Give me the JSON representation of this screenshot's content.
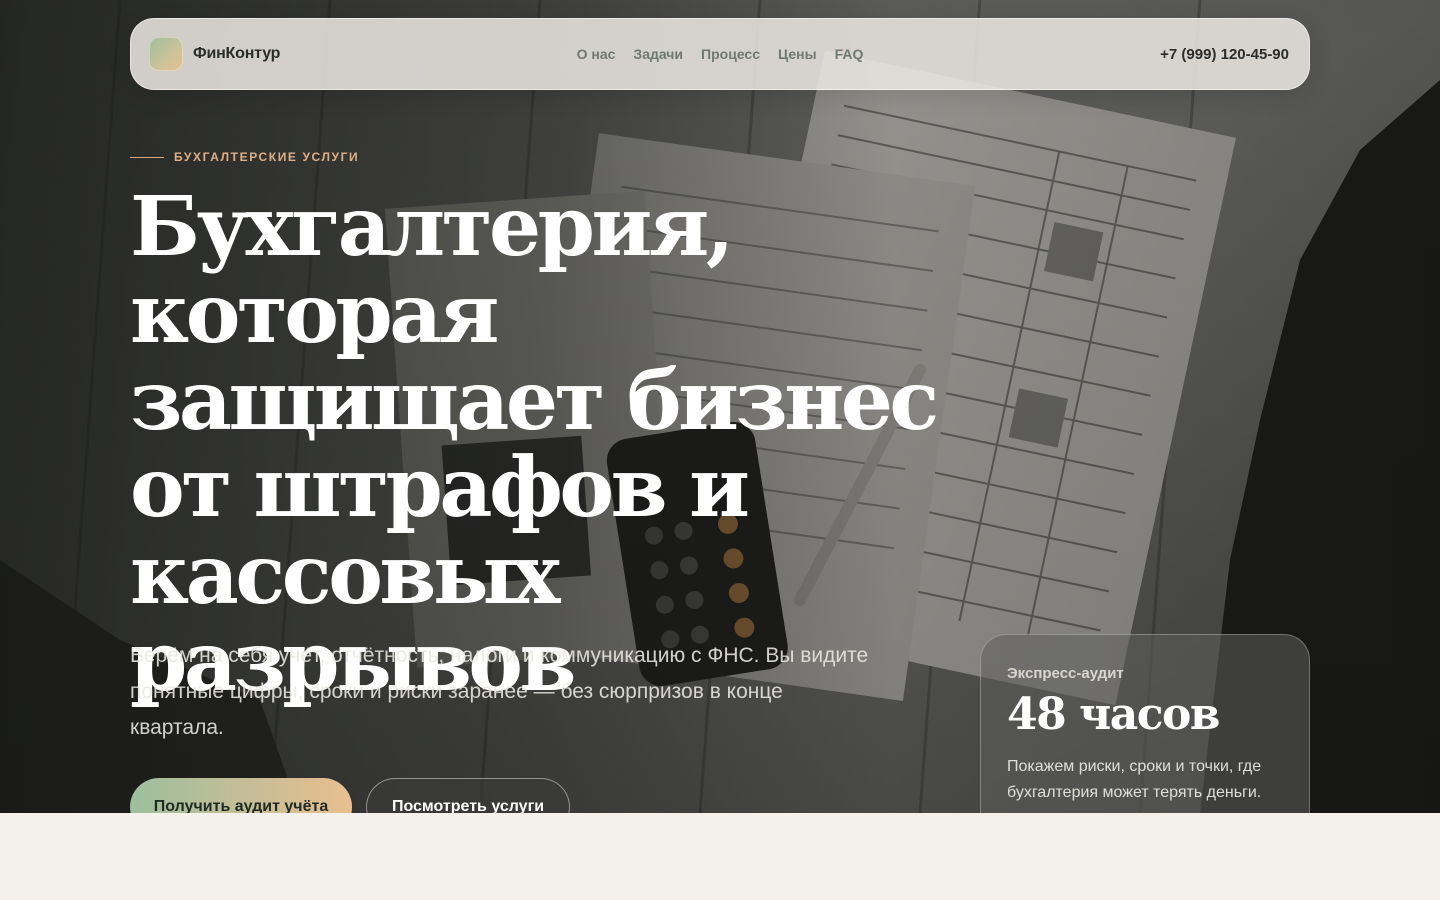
{
  "nav": {
    "brand": "ФинКонтур",
    "links": [
      "О нас",
      "Задачи",
      "Процесс",
      "Цены",
      "FAQ"
    ],
    "phone": "+7 (999) 120-45-90"
  },
  "hero": {
    "eyebrow": "БУХГАЛТЕРСКИЕ УСЛУГИ",
    "headline": "Бухгалтерия, которая защищает бизнес от штрафов и кассовых разрывов",
    "subtext": "Берём на себя учёт, отчётность, налоги и коммуникацию с ФНС. Вы видите понятные цифры, сроки и риски заранее — без сюрпризов в конце квартала.",
    "primary_cta": "Получить аудит учёта",
    "secondary_cta": "Посмотреть услуги"
  },
  "audit_card": {
    "label": "Экспресс-аудит",
    "value": "48 часов",
    "description": "Покажем риски, сроки и точки, где бухгалтерия может терять деньги."
  },
  "colors": {
    "accent_gold": "#e0b084",
    "cta_gradient_start": "#9bbf9c",
    "cta_gradient_end": "#e8c08e",
    "page_bg": "#f4f0ea"
  }
}
